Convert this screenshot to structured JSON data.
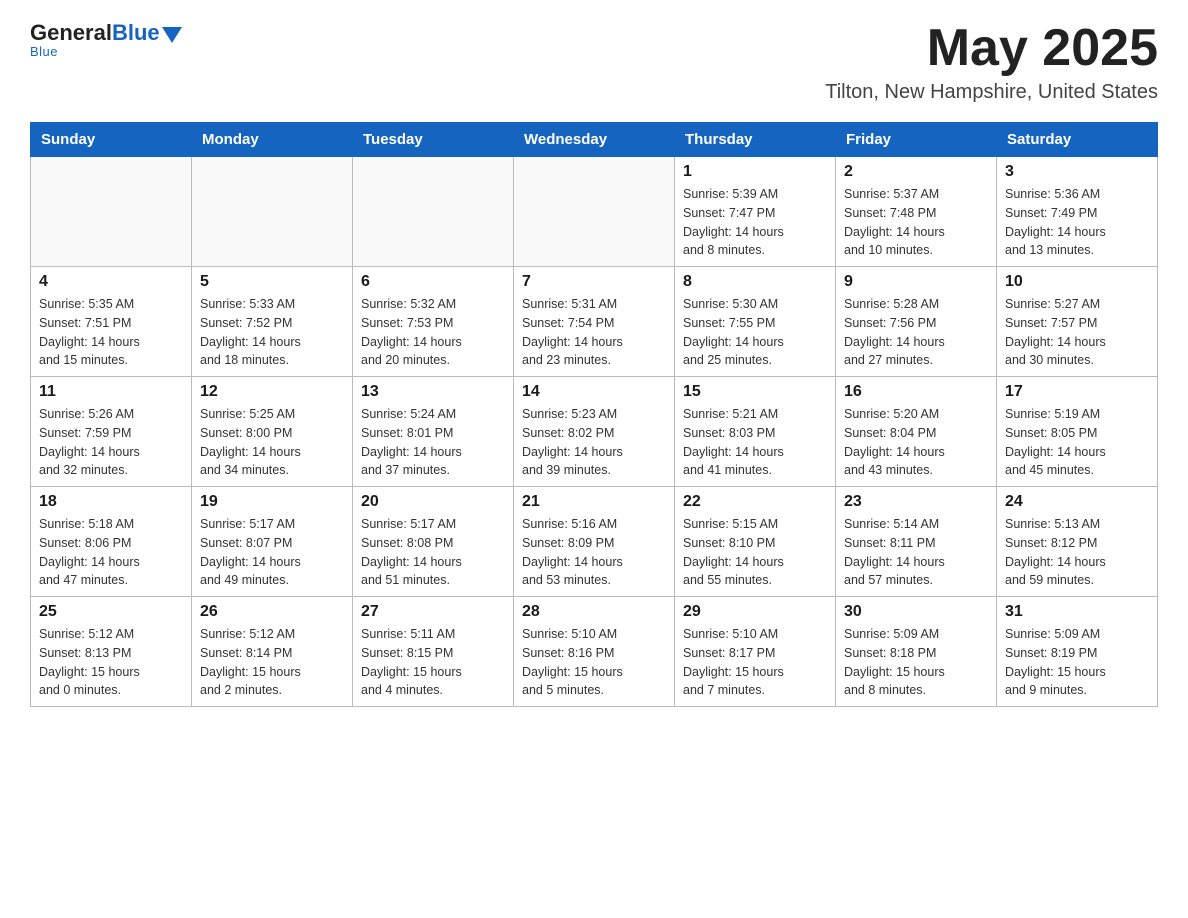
{
  "header": {
    "logo_general": "General",
    "logo_blue": "Blue",
    "month": "May 2025",
    "location": "Tilton, New Hampshire, United States"
  },
  "weekdays": [
    "Sunday",
    "Monday",
    "Tuesday",
    "Wednesday",
    "Thursday",
    "Friday",
    "Saturday"
  ],
  "weeks": [
    [
      {
        "day": "",
        "info": ""
      },
      {
        "day": "",
        "info": ""
      },
      {
        "day": "",
        "info": ""
      },
      {
        "day": "",
        "info": ""
      },
      {
        "day": "1",
        "info": "Sunrise: 5:39 AM\nSunset: 7:47 PM\nDaylight: 14 hours\nand 8 minutes."
      },
      {
        "day": "2",
        "info": "Sunrise: 5:37 AM\nSunset: 7:48 PM\nDaylight: 14 hours\nand 10 minutes."
      },
      {
        "day": "3",
        "info": "Sunrise: 5:36 AM\nSunset: 7:49 PM\nDaylight: 14 hours\nand 13 minutes."
      }
    ],
    [
      {
        "day": "4",
        "info": "Sunrise: 5:35 AM\nSunset: 7:51 PM\nDaylight: 14 hours\nand 15 minutes."
      },
      {
        "day": "5",
        "info": "Sunrise: 5:33 AM\nSunset: 7:52 PM\nDaylight: 14 hours\nand 18 minutes."
      },
      {
        "day": "6",
        "info": "Sunrise: 5:32 AM\nSunset: 7:53 PM\nDaylight: 14 hours\nand 20 minutes."
      },
      {
        "day": "7",
        "info": "Sunrise: 5:31 AM\nSunset: 7:54 PM\nDaylight: 14 hours\nand 23 minutes."
      },
      {
        "day": "8",
        "info": "Sunrise: 5:30 AM\nSunset: 7:55 PM\nDaylight: 14 hours\nand 25 minutes."
      },
      {
        "day": "9",
        "info": "Sunrise: 5:28 AM\nSunset: 7:56 PM\nDaylight: 14 hours\nand 27 minutes."
      },
      {
        "day": "10",
        "info": "Sunrise: 5:27 AM\nSunset: 7:57 PM\nDaylight: 14 hours\nand 30 minutes."
      }
    ],
    [
      {
        "day": "11",
        "info": "Sunrise: 5:26 AM\nSunset: 7:59 PM\nDaylight: 14 hours\nand 32 minutes."
      },
      {
        "day": "12",
        "info": "Sunrise: 5:25 AM\nSunset: 8:00 PM\nDaylight: 14 hours\nand 34 minutes."
      },
      {
        "day": "13",
        "info": "Sunrise: 5:24 AM\nSunset: 8:01 PM\nDaylight: 14 hours\nand 37 minutes."
      },
      {
        "day": "14",
        "info": "Sunrise: 5:23 AM\nSunset: 8:02 PM\nDaylight: 14 hours\nand 39 minutes."
      },
      {
        "day": "15",
        "info": "Sunrise: 5:21 AM\nSunset: 8:03 PM\nDaylight: 14 hours\nand 41 minutes."
      },
      {
        "day": "16",
        "info": "Sunrise: 5:20 AM\nSunset: 8:04 PM\nDaylight: 14 hours\nand 43 minutes."
      },
      {
        "day": "17",
        "info": "Sunrise: 5:19 AM\nSunset: 8:05 PM\nDaylight: 14 hours\nand 45 minutes."
      }
    ],
    [
      {
        "day": "18",
        "info": "Sunrise: 5:18 AM\nSunset: 8:06 PM\nDaylight: 14 hours\nand 47 minutes."
      },
      {
        "day": "19",
        "info": "Sunrise: 5:17 AM\nSunset: 8:07 PM\nDaylight: 14 hours\nand 49 minutes."
      },
      {
        "day": "20",
        "info": "Sunrise: 5:17 AM\nSunset: 8:08 PM\nDaylight: 14 hours\nand 51 minutes."
      },
      {
        "day": "21",
        "info": "Sunrise: 5:16 AM\nSunset: 8:09 PM\nDaylight: 14 hours\nand 53 minutes."
      },
      {
        "day": "22",
        "info": "Sunrise: 5:15 AM\nSunset: 8:10 PM\nDaylight: 14 hours\nand 55 minutes."
      },
      {
        "day": "23",
        "info": "Sunrise: 5:14 AM\nSunset: 8:11 PM\nDaylight: 14 hours\nand 57 minutes."
      },
      {
        "day": "24",
        "info": "Sunrise: 5:13 AM\nSunset: 8:12 PM\nDaylight: 14 hours\nand 59 minutes."
      }
    ],
    [
      {
        "day": "25",
        "info": "Sunrise: 5:12 AM\nSunset: 8:13 PM\nDaylight: 15 hours\nand 0 minutes."
      },
      {
        "day": "26",
        "info": "Sunrise: 5:12 AM\nSunset: 8:14 PM\nDaylight: 15 hours\nand 2 minutes."
      },
      {
        "day": "27",
        "info": "Sunrise: 5:11 AM\nSunset: 8:15 PM\nDaylight: 15 hours\nand 4 minutes."
      },
      {
        "day": "28",
        "info": "Sunrise: 5:10 AM\nSunset: 8:16 PM\nDaylight: 15 hours\nand 5 minutes."
      },
      {
        "day": "29",
        "info": "Sunrise: 5:10 AM\nSunset: 8:17 PM\nDaylight: 15 hours\nand 7 minutes."
      },
      {
        "day": "30",
        "info": "Sunrise: 5:09 AM\nSunset: 8:18 PM\nDaylight: 15 hours\nand 8 minutes."
      },
      {
        "day": "31",
        "info": "Sunrise: 5:09 AM\nSunset: 8:19 PM\nDaylight: 15 hours\nand 9 minutes."
      }
    ]
  ]
}
